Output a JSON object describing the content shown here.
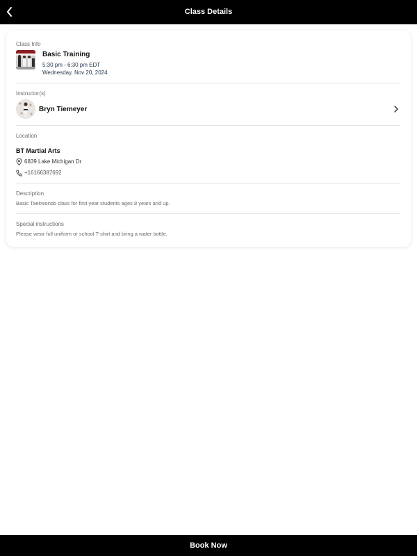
{
  "header": {
    "title": "Class Details",
    "back_icon": "chevron-left-icon"
  },
  "class_info": {
    "label": "Class Info",
    "name": "Basic Training",
    "time": "5:30 pm - 6:30 pm EDT",
    "date": "Wednesday, Nov 20, 2024"
  },
  "instructors": {
    "label": "Instructor(s)",
    "items": [
      {
        "name": "Bryn Tiemeyer"
      }
    ]
  },
  "location": {
    "label": "Location",
    "name": "BT Martial Arts",
    "address": "6839 Lake Michigan Dr",
    "phone": "+16166387692"
  },
  "description": {
    "label": "Description",
    "text": "Basic Taekwondo class for first year students ages 8 years and up."
  },
  "special_instructions": {
    "label": "Special instructions",
    "text": "Please wear full uniform or school T-shirt and bring a water bottle."
  },
  "footer": {
    "book_label": "Book Now"
  },
  "colors": {
    "bar": "#000000",
    "card": "#ffffff",
    "muted_text": "#6b6b6b",
    "date_text": "#263a4f",
    "divider": "#e3e3e3"
  }
}
